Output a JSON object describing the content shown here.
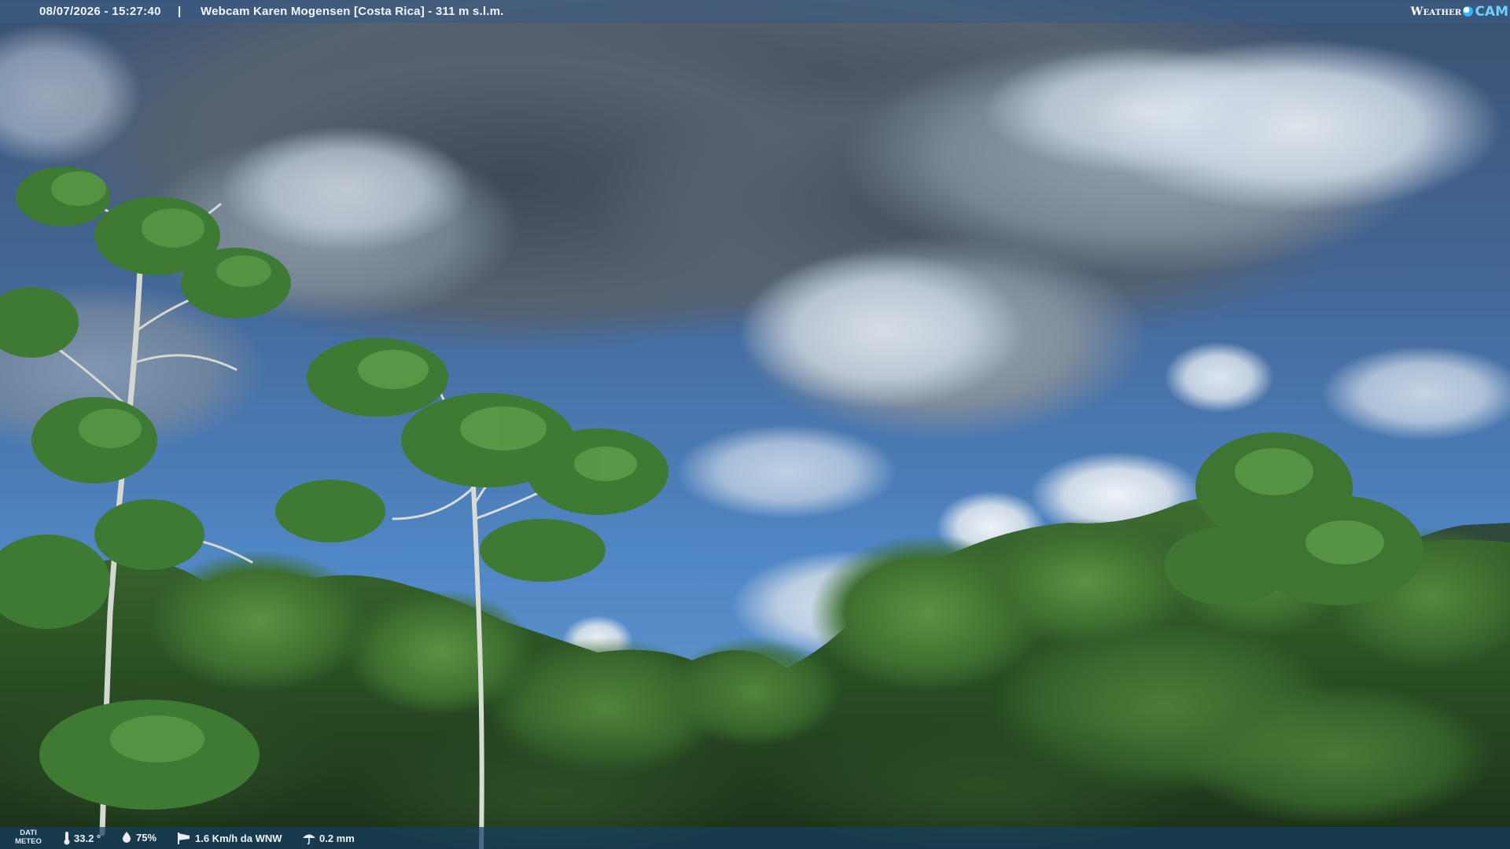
{
  "header": {
    "timestamp": "08/07/2026 - 15:27:40",
    "separator": "|",
    "camera_title": "Webcam Karen Mogensen [Costa Rica] - 311 m s.l.m."
  },
  "logo": {
    "part1": "Weather",
    "part2": "CAM",
    "icon": "globe-icon"
  },
  "weather": {
    "label_line1": "DATI",
    "label_line2": "METEO",
    "temperature": "33.2 °",
    "humidity": "75%",
    "wind": "1.6 Km/h da WNW",
    "rain": "0.2 mm",
    "icons": {
      "temperature": "thermometer-icon",
      "humidity": "droplet-icon",
      "wind": "windsock-icon",
      "rain": "umbrella-icon"
    }
  },
  "colors": {
    "sky_top": "#3f5a7a",
    "sky_mid": "#4a7cb8",
    "cloud": "#d9e3ee",
    "storm_cloud": "#4b5866",
    "forest_dark": "#1f3a1c",
    "forest_light": "#4f8a3a",
    "bar_top": "#3a5b82",
    "bar_bottom": "#163e60",
    "logo_accent": "#38b5ff"
  }
}
